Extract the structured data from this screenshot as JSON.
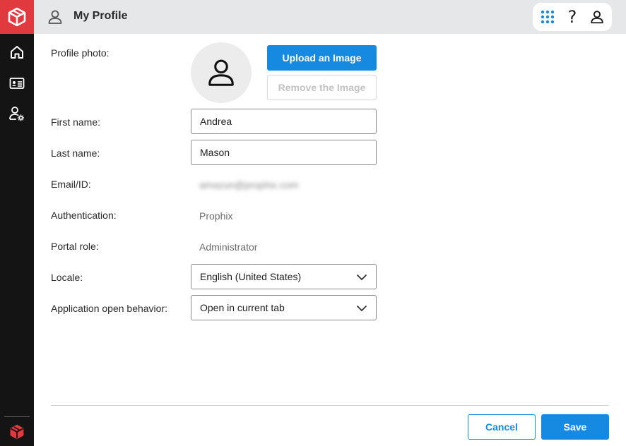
{
  "header": {
    "title": "My Profile"
  },
  "sidebar": {
    "items": [
      {
        "icon": "home-icon"
      },
      {
        "icon": "id-card-icon"
      },
      {
        "icon": "user-settings-icon"
      }
    ]
  },
  "toolbar": {
    "apps_icon": "apps-grid-icon",
    "help_label": "?",
    "profile_icon": "user-icon"
  },
  "form": {
    "profile_photo_label": "Profile photo:",
    "upload_label": "Upload an Image",
    "remove_label": "Remove the Image",
    "first_name_label": "First name:",
    "first_name_value": "Andrea",
    "last_name_label": "Last name:",
    "last_name_value": "Mason",
    "email_label": "Email/ID:",
    "email_value": "amazun@prophix.com",
    "authentication_label": "Authentication:",
    "authentication_value": "Prophix",
    "portal_role_label": "Portal role:",
    "portal_role_value": "Administrator",
    "locale_label": "Locale:",
    "locale_value": "English (United States)",
    "open_behavior_label": "Application open behavior:",
    "open_behavior_value": "Open in current tab"
  },
  "footer": {
    "cancel_label": "Cancel",
    "save_label": "Save"
  },
  "colors": {
    "accent": "#1689e0",
    "brand": "#e0393e",
    "sidebar": "#141414",
    "header": "#e6e7e9"
  }
}
